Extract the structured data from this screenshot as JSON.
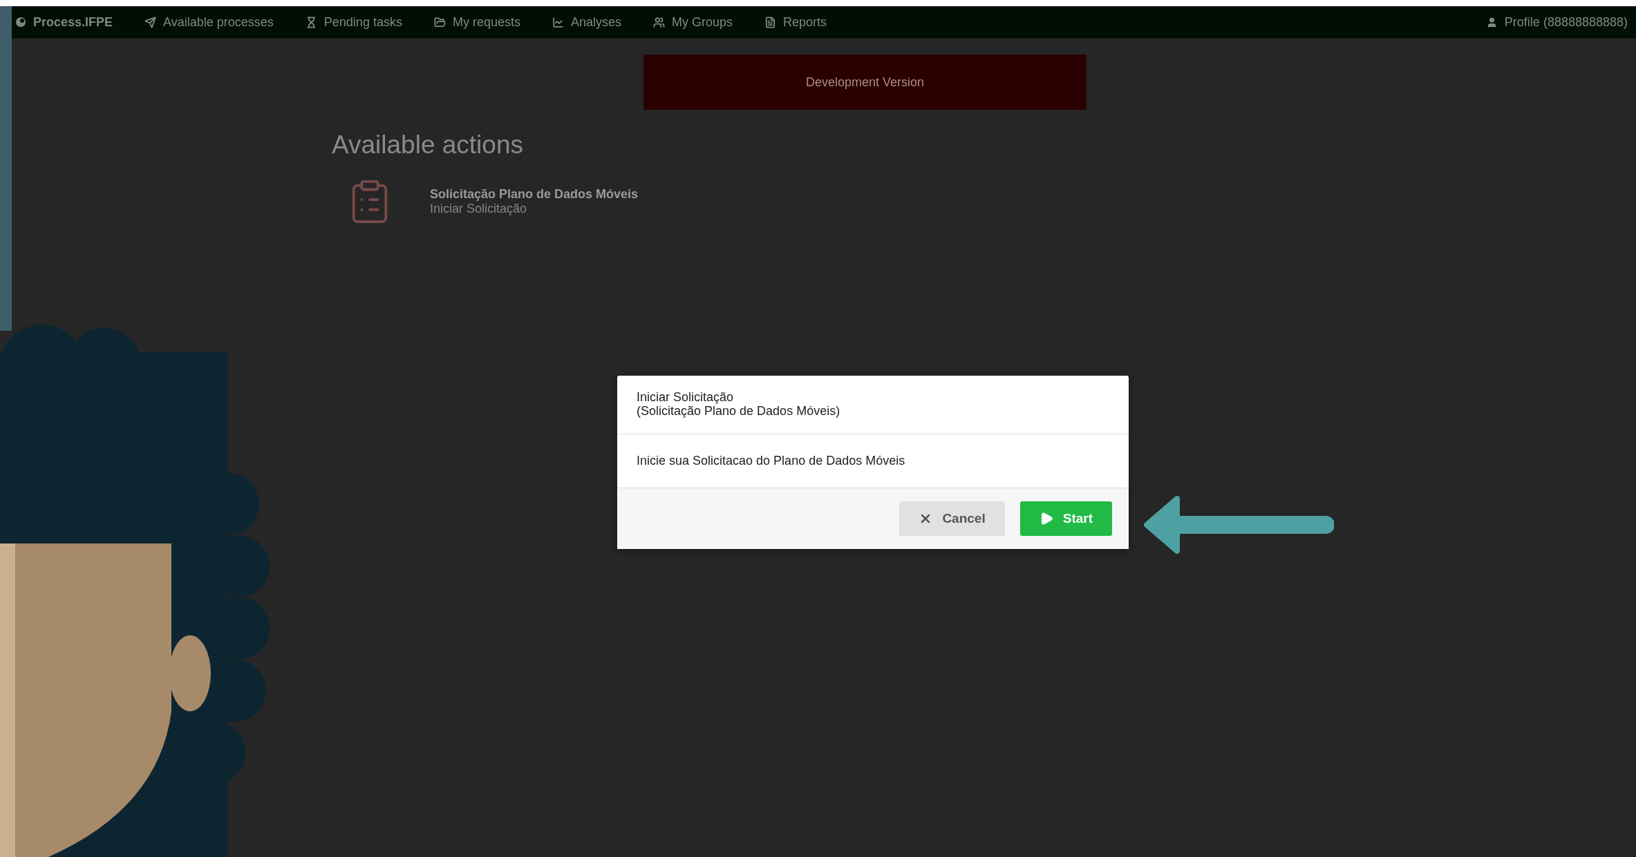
{
  "navbar": {
    "brand": "Process.IFPE",
    "items": [
      {
        "label": "Available processes"
      },
      {
        "label": "Pending tasks"
      },
      {
        "label": "My requests"
      },
      {
        "label": "Analyses"
      },
      {
        "label": "My Groups"
      },
      {
        "label": "Reports"
      }
    ],
    "profile": "Profile (88888888888)"
  },
  "banner": "Development Version",
  "heading": "Available actions",
  "actions": [
    {
      "title": "Solicitação Plano de Dados Móveis",
      "subtitle": "Iniciar Solicitação"
    }
  ],
  "modal": {
    "title_lines": [
      "Iniciar Solicitação",
      "(Solicitação Plano de Dados Móveis)"
    ],
    "body": "Inicie sua Solicitacao do Plano de Dados Móveis",
    "buttons": [
      {
        "kind": "cancel",
        "label": "Cancel"
      },
      {
        "kind": "start",
        "label": "Start"
      }
    ]
  }
}
